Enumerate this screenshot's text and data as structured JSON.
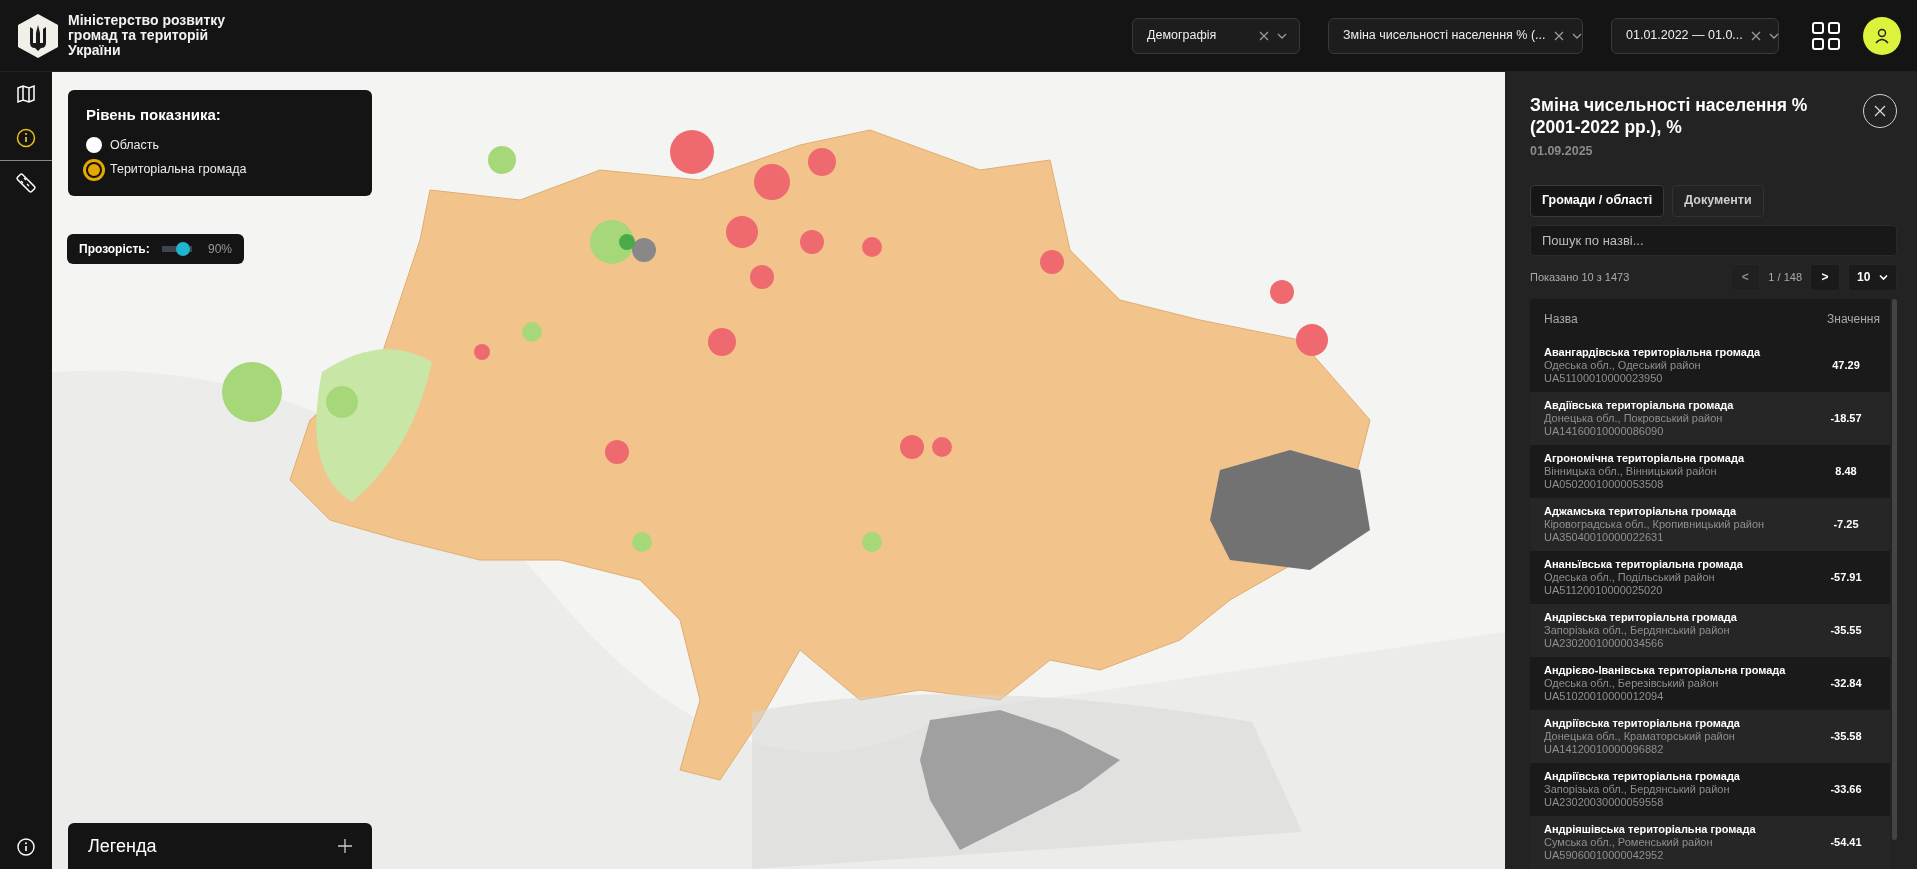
{
  "header": {
    "title_lines": [
      "Міністерство розвитку",
      "громад та територій",
      "України"
    ],
    "filters": [
      {
        "value": "Демографія"
      },
      {
        "value": "Зміна чисельності населення % (..."
      },
      {
        "value": "01.01.2022 — 01.0..."
      }
    ]
  },
  "sidebar": {
    "items": [
      {
        "kind": "map",
        "selected": false
      },
      {
        "kind": "info",
        "selected": true
      },
      {
        "kind": "ruler",
        "selected": false
      }
    ]
  },
  "level_panel": {
    "title": "Рівень показника:",
    "options": [
      {
        "label": "Область",
        "selected": false
      },
      {
        "label": "Територіальна громада",
        "selected": true
      }
    ]
  },
  "opacity": {
    "label": "Прозорість:",
    "level": 0.9,
    "reading": "90%"
  },
  "legend": {
    "title": "Легенда",
    "expanded": false
  },
  "panel": {
    "title": "Зміна чисельності населення % (2001-2022 рр.), %",
    "date": "01.09.2025",
    "tabs": [
      {
        "label": "Громади / області",
        "selected": true
      },
      {
        "label": "Документи",
        "selected": false
      }
    ],
    "search": {
      "placeholder": "Пошук по назві..."
    },
    "summary": "Показано 10 з 1473",
    "pager": {
      "prev": {
        "label": "<",
        "disabled": true
      },
      "page": "1 / 148",
      "next": {
        "label": ">",
        "disabled": false
      },
      "page_size": "10"
    },
    "table": {
      "columns": [
        "Назва",
        "Значення"
      ],
      "rows": [
        {
          "name": "Авангардівська територіальна громада",
          "location": "Одеська обл., Одеський район",
          "code": "UA51100010000023950",
          "value": "47.29"
        },
        {
          "name": "Авдіївська територіальна громада",
          "location": "Донецька обл., Покровський район",
          "code": "UA14160010000086090",
          "value": "-18.57"
        },
        {
          "name": "Агрономічна територіальна громада",
          "location": "Вінницька обл., Вінницький район",
          "code": "UA05020010000053508",
          "value": "8.48"
        },
        {
          "name": "Аджамська територіальна громада",
          "location": "Кіровоградська обл., Кропивницький район",
          "code": "UA35040010000022631",
          "value": "-7.25"
        },
        {
          "name": "Ананьївська територіальна громада",
          "location": "Одеська обл., Подільський район",
          "code": "UA51120010000025020",
          "value": "-57.91"
        },
        {
          "name": "Андрівська територіальна громада",
          "location": "Запорізька обл., Бердянський район",
          "code": "UA23020010000034566",
          "value": "-35.55"
        },
        {
          "name": "Андрієво-Іванівська територіальна громада",
          "location": "Одеська обл., Березівський район",
          "code": "UA51020010000012094",
          "value": "-32.84"
        },
        {
          "name": "Андріївська територіальна громада",
          "location": "Донецька обл., Краматорський район",
          "code": "UA14120010000096882",
          "value": "-35.58"
        },
        {
          "name": "Андріївська територіальна громада",
          "location": "Запорізька обл., Бердянський район",
          "code": "UA23020030000059558",
          "value": "-33.66"
        },
        {
          "name": "Андріяшівська територіальна громада",
          "location": "Сумська обл., Роменський район",
          "code": "UA59060010000042952",
          "value": "-54.41"
        }
      ]
    }
  }
}
